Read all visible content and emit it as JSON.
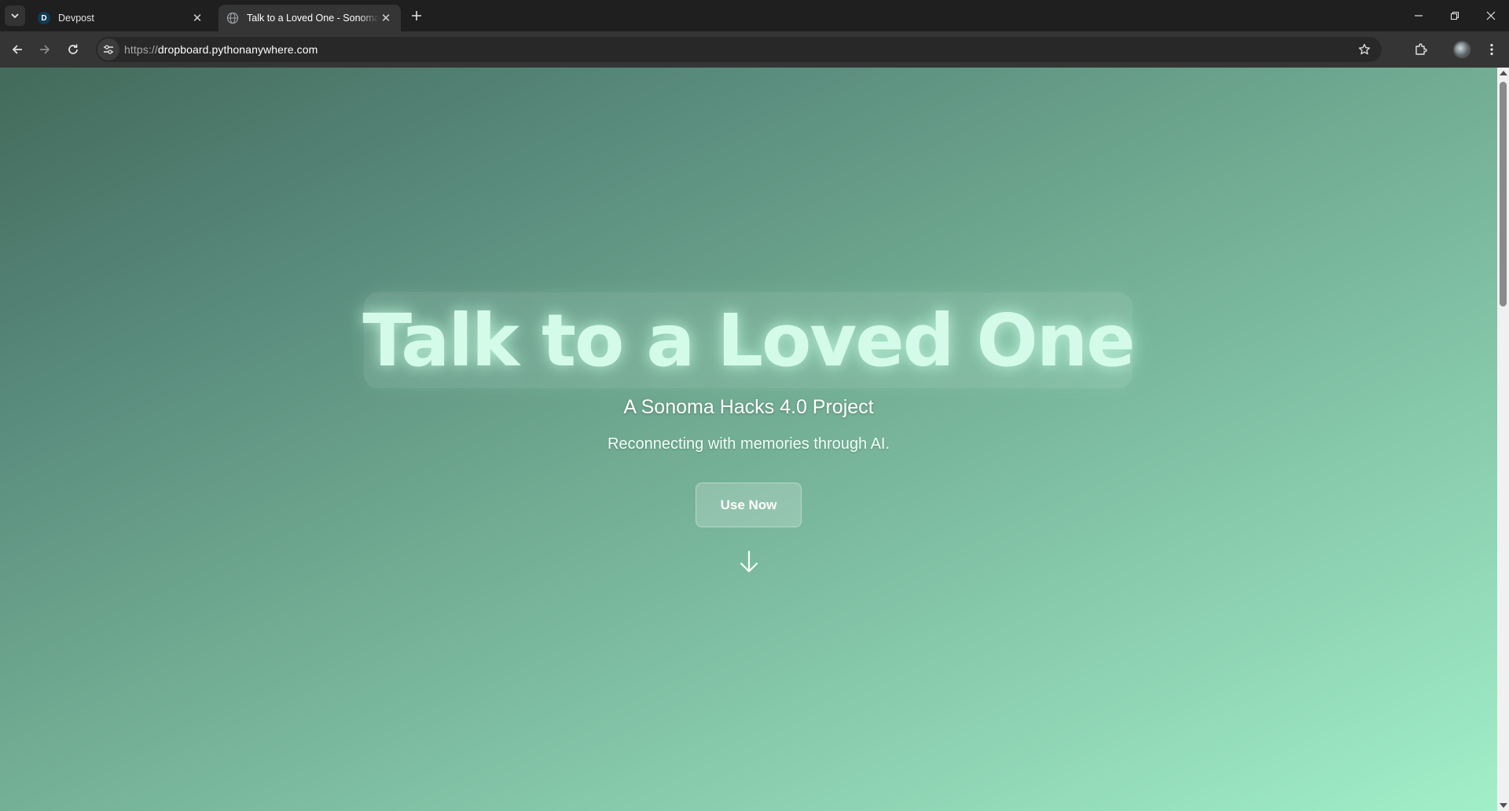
{
  "browser": {
    "tabs": [
      {
        "title": "Devpost",
        "favicon": "D",
        "active": false
      },
      {
        "title": "Talk to a Loved One - Sonoma H",
        "favicon": "globe-icon",
        "active": true
      }
    ],
    "url": {
      "scheme": "https://",
      "host": "dropboard.pythonanywhere.com"
    }
  },
  "page": {
    "title": "Talk to a Loved One",
    "subtitle": "A Sonoma Hacks 4.0 Project",
    "tagline": "Reconnecting with memories through AI.",
    "cta_label": "Use Now"
  },
  "colors": {
    "gradient_start": "#436a5b",
    "gradient_end": "#a1efc9",
    "title_glow": "#d4fbe9"
  }
}
